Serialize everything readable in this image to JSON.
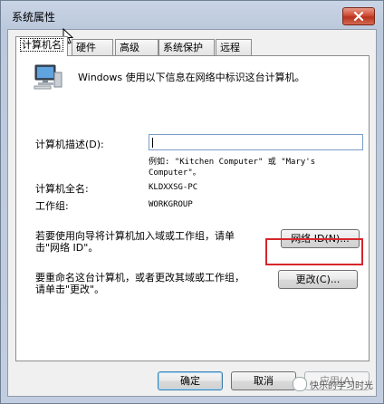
{
  "window": {
    "title": "系统属性"
  },
  "tabs": [
    {
      "label": "计算机名",
      "active": true
    },
    {
      "label": "硬件",
      "active": false
    },
    {
      "label": "高级",
      "active": false
    },
    {
      "label": "系统保护",
      "active": false
    },
    {
      "label": "远程",
      "active": false
    }
  ],
  "panel": {
    "intro": "Windows 使用以下信息在网络中标识这台计算机。",
    "description_label": "计算机描述(D):",
    "description_value": "",
    "example_line1": "例如: \"Kitchen Computer\" 或 \"Mary's",
    "example_line2": "Computer\"。",
    "fullname_label": "计算机全名:",
    "fullname_value": "KLDXXSG-PC",
    "workgroup_label": "工作组:",
    "workgroup_value": "WORKGROUP",
    "network_text_line1": "若要使用向导将计算机加入域或工作组，请单",
    "network_text_line2": "击\"网络 ID\"。",
    "network_button": "网络 ID(N)...",
    "rename_text_line1": "要重命名这台计算机，或者更改其域或工作组，",
    "rename_text_line2": "请单击\"更改\"。",
    "change_button": "更改(C)..."
  },
  "footer": {
    "ok": "确定",
    "cancel": "取消",
    "apply": "应用(A)"
  },
  "watermark": "快乐的学习时光",
  "colors": {
    "highlight": "#d6262b",
    "close_button": "#cf4b33"
  }
}
